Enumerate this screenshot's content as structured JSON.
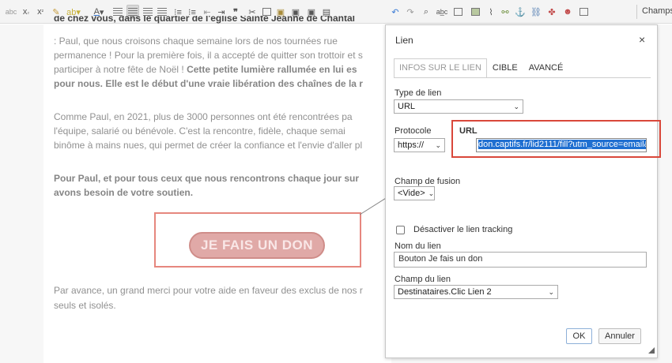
{
  "toolbar": {
    "champs_label": "Champs"
  },
  "editor": {
    "lines": [
      {
        "html_parts": [
          {
            "t": "de chez vous, dans le quartier de l'église Sainte Jeanne de Chantal",
            "b": true
          }
        ]
      },
      {
        "html_parts": [
          {
            "t": ": Paul, que nous croisons chaque semaine lors de nos tournées rue"
          }
        ]
      },
      {
        "html_parts": [
          {
            "t": "permanence ! Pour la première fois, il a accepté de quitter son trottoir et s"
          }
        ]
      },
      {
        "html_parts": [
          {
            "t": "participer à notre fête de Noël ! "
          },
          {
            "t": "Cette petite lumière rallumée en lui es",
            "b": true
          }
        ]
      },
      {
        "html_parts": [
          {
            "t": "pour nous. Elle est le début d'une vraie libération des chaînes de la r",
            "b": true
          }
        ]
      },
      {
        "html_parts": [
          {
            "t": "Comme Paul, en 2021, plus de 3000 personnes ont été rencontrées pa"
          }
        ]
      },
      {
        "html_parts": [
          {
            "t": "l'équipe, salarié ou bénévole. C'est la rencontre, fidèle, chaque semai"
          }
        ]
      },
      {
        "html_parts": [
          {
            "t": "binôme à mains nues, qui permet de créer la confiance et l'envie d'aller pl"
          }
        ]
      },
      {
        "html_parts": [
          {
            "t": "Pour Paul, et pour tous ceux que nous rencontrons chaque jour sur",
            "b": true
          }
        ]
      },
      {
        "html_parts": [
          {
            "t": "avons besoin de votre soutien.",
            "b": true
          }
        ]
      },
      {
        "html_parts": [
          {
            "t": "Par avance, un grand merci pour votre aide en faveur des exclus de nos r"
          }
        ]
      },
      {
        "html_parts": [
          {
            "t": "seuls et isolés."
          }
        ]
      }
    ],
    "donate_button": "JE FAIS UN DON"
  },
  "dialog": {
    "title": "Lien",
    "close": "×",
    "tabs": [
      {
        "label": "INFOS SUR LE LIEN",
        "active": true
      },
      {
        "label": "CIBLE",
        "active": false
      },
      {
        "label": "AVANCÉ",
        "active": false
      }
    ],
    "type_label": "Type de lien",
    "type_value": "URL",
    "protocol_label": "Protocole",
    "protocol_value": "https://",
    "url_label": "URL",
    "url_value": "don.captifs.fr/lid2111/fill?utm_source=email&u",
    "merge_label": "Champ de fusion",
    "merge_value": "<Vide>",
    "tracking_label": "Désactiver le lien tracking",
    "link_name_label": "Nom du lien",
    "link_name_value": "Bouton Je fais un don",
    "link_field_label": "Champ du lien",
    "link_field_value": "Destinataires.Clic Lien 2",
    "ok_label": "OK",
    "cancel_label": "Annuler"
  },
  "colors": {
    "highlight_red": "#d9473a",
    "selection_blue": "#1f6fd1",
    "donate_fill": "#d07b78"
  }
}
